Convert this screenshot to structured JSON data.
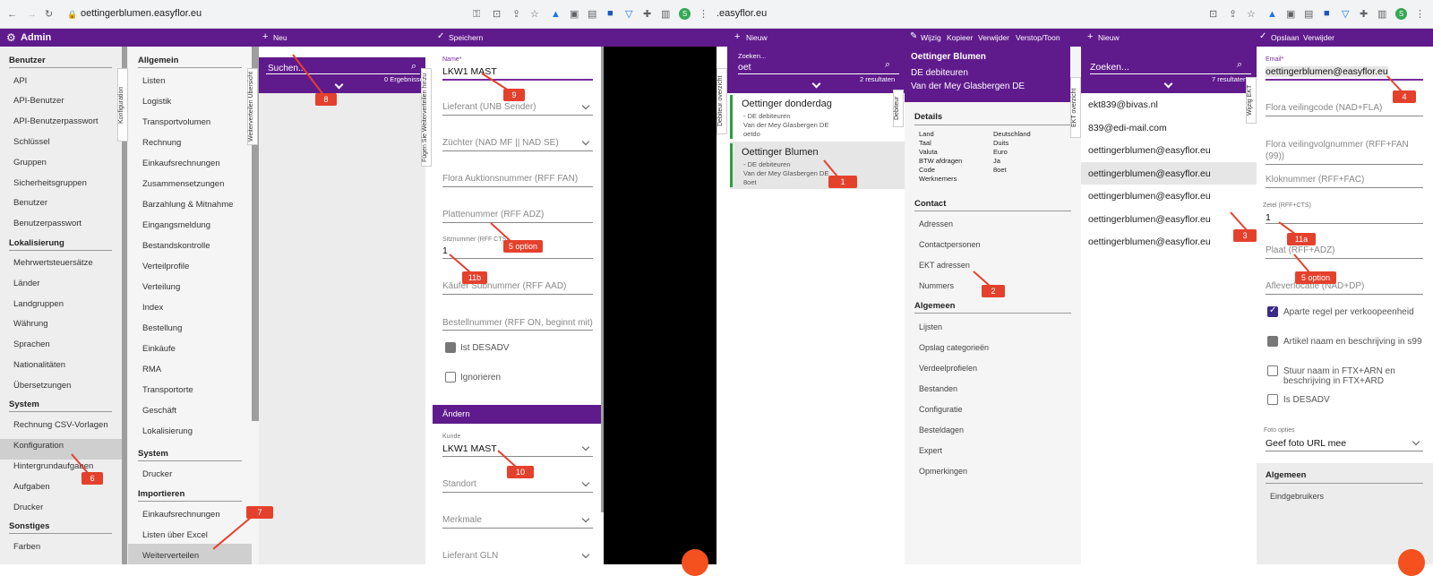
{
  "browser_left": {
    "url": "oettingerblumen.easyflor.eu"
  },
  "browser_right": {
    "url": ".easyflor.eu"
  },
  "app": {
    "brand": "Admin",
    "toolbar": {
      "new_label": "Neu",
      "save_label": "Speichern"
    }
  },
  "nav": {
    "groups": [
      {
        "title": "Benutzer",
        "items": [
          "API",
          "API-Benutzer",
          "API-Benutzerpasswort",
          "Schlüssel",
          "Gruppen",
          "Sicherheitsgruppen",
          "Benutzer",
          "Benutzerpasswort"
        ]
      },
      {
        "title": "Lokalisierung",
        "items": [
          "Mehrwertsteuersätze",
          "Länder",
          "Landgruppen",
          "Währung",
          "Sprachen",
          "Nationalitäten",
          "Übersetzungen"
        ]
      },
      {
        "title": "System",
        "items": [
          "Rechnung CSV-Vorlagen",
          "Konfiguration",
          "Hintergrundaufgaben",
          "Aufgaben",
          "Drucker"
        ]
      },
      {
        "title": "Sonstiges",
        "items": [
          "Farben"
        ]
      }
    ]
  },
  "nav2": {
    "groups": [
      {
        "title": "Allgemein",
        "items": [
          "Listen",
          "Logistik",
          "Transportvolumen",
          "Rechnung",
          "Einkaufsrechnungen",
          "Zusammensetzungen",
          "Barzahlung & Mitnahme",
          "Eingangsmeldung",
          "Bestandskontrolle",
          "Verteilprofile",
          "Verteilung",
          "Index",
          "Bestellung",
          "Einkäufe",
          "RMA",
          "Transportorte",
          "Geschäft",
          "Lokalisierung"
        ]
      },
      {
        "title": "System",
        "items": [
          "Drucker"
        ]
      },
      {
        "title": "Importieren",
        "items": [
          "Einkaufsrechnungen",
          "Listen über Excel",
          "Weiterverteilen"
        ]
      }
    ]
  },
  "vtabs": {
    "konfiguration": "Konfiguration",
    "weiterverteilen": "Weiterverteilen Übersicht",
    "fuegen": "Fügen Sie Weiterverteilen hinzu",
    "debiteur_overzicht": "Debiteur overzicht",
    "debiteur": "Debiteur",
    "ekt_overzicht": "EKT overzicht",
    "wijzig_ekt": "Wijzig EKT"
  },
  "search1": {
    "placeholder": "Suchen...",
    "count": "0 Ergebnisse"
  },
  "form1": {
    "name_label": "Name*",
    "name_value": "LKW1 MAST",
    "lieferant": "Lieferant (UNB Sender)",
    "zuechter": "Züchter (NAD MF || NAD SE)",
    "flora_auktion": "Flora Auktionsnummer (RFF FAN)",
    "platten": "Plattenummer (RFF ADZ)",
    "sitz_label": "Sitznummer (RFF CTS)",
    "sitz_value": "1",
    "kaeufer_sub": "Käufer Subnummer (RFF AAD)",
    "bestellnummer": "Bestellnummer (RFF ON, beginnt mit)",
    "ist_desadv": "Ist DESADV",
    "ignorieren": "Ignorieren",
    "section_change": "Ändern",
    "kunde_label": "Kunde",
    "kunde_value": "LKW1 MAST",
    "standort": "Standort",
    "merkmale": "Merkmale",
    "lieferant_gln": "Lieferant GLN"
  },
  "right": {
    "toolbar": {
      "new_label": "Nieuw",
      "edit": "Wijzig",
      "copy": "Kopieer",
      "delete": "Verwijder",
      "hide": "Verstop/Toon",
      "new2": "Nieuw",
      "save": "Opslaan",
      "delete2": "Verwijder"
    },
    "search": {
      "label": "Zoeken...",
      "value": "oet",
      "count": "2 resultaten"
    },
    "debtors": [
      {
        "name": "Oettinger donderdag",
        "l1": "- DE debiteuren",
        "l2": "Van der Mey Glasbergen DE",
        "l3": "oetdo"
      },
      {
        "name": "Oettinger Blumen",
        "l1": "- DE debiteuren",
        "l2": "Van der Mey Glasbergen DE",
        "l3": "8oet"
      }
    ],
    "detail": {
      "title": "Oettinger Blumen",
      "sub1": "DE debiteuren",
      "sub2": "Van der Mey Glasbergen DE",
      "details_h": "Details",
      "kv": [
        [
          "Land",
          "Deutschland"
        ],
        [
          "Taal",
          "Duits"
        ],
        [
          "Valuta",
          "Euro"
        ],
        [
          "BTW afdragen",
          "Ja"
        ],
        [
          "Code",
          "8oet"
        ],
        [
          "Werknemers",
          ""
        ]
      ],
      "contact_h": "Contact",
      "contact": [
        "Adressen",
        "Contactpersonen",
        "EKT adressen",
        "Nummers"
      ],
      "algemeen_h": "Algemeen",
      "algemeen": [
        "Lijsten",
        "Opslag categorieën",
        "Verdeelprofielen",
        "Bestanden",
        "Configuratie",
        "Besteldagen",
        "Expert",
        "Opmerkingen"
      ]
    },
    "search2": {
      "label": "Zoeken...",
      "count": "7 resultaten"
    },
    "emails": [
      "ekt839@bivas.nl",
      "839@edi-mail.com",
      "oettingerblumen@easyflor.eu",
      "oettingerblumen@easyflor.eu",
      "oettingerblumen@easyflor.eu",
      "oettingerblumen@easyflor.eu",
      "oettingerblumen@easyflor.eu"
    ],
    "form": {
      "email_label": "Email*",
      "email_value": "oettingerblumen@easyflor.eu",
      "flora_veil": "Flora veilingcode (NAD+FLA)",
      "flora_volg": "Flora veilingvolgnummer (RFF+FAN (99))",
      "klok": "Kloknummer (RFF+FAC)",
      "zetel_label": "Zetel (RFF+CTS)",
      "zetel_value": "1",
      "plaat": "Plaat (RFF+ADZ)",
      "aflever": "Afleverlocatie (NAD+DP)",
      "aparte": "Aparte regel per verkoopeenheid",
      "artikel": "Artikel naam en beschrijving in s99",
      "stuur": "Stuur naam in FTX+ARN en beschrijving in FTX+ARD",
      "is_desadv": "Is DESADV",
      "foto_label": "Foto opties",
      "foto_value": "Geef foto URL mee",
      "algemeen": "Algemeen",
      "eind": "Eindgebruikers"
    }
  },
  "callouts": [
    "8",
    "9",
    "5 option",
    "11b",
    "6",
    "7",
    "10",
    "1",
    "2",
    "3",
    "11a",
    "5 option",
    "4"
  ],
  "colors": {
    "brand": "#5f1a8c",
    "callout": "#e4412d",
    "sidebar": "#eeeeee"
  }
}
